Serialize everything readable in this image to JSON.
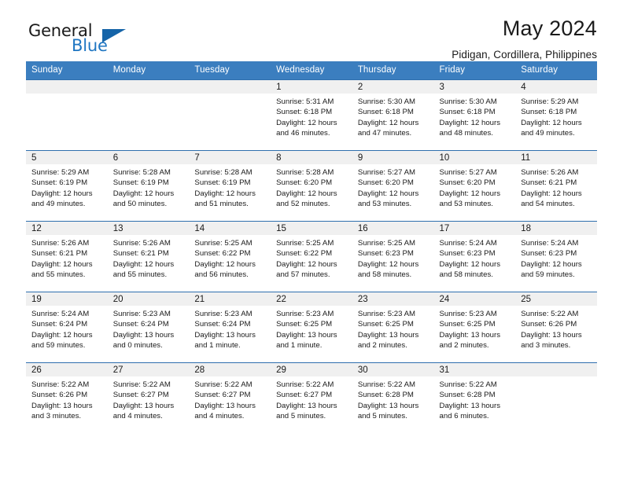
{
  "brand": {
    "name_top": "General",
    "name_bottom": "Blue",
    "triangle_color": "#1564a8",
    "blue_text_color": "#1f76c2"
  },
  "header": {
    "title": "May 2024",
    "subtitle": "Pidigan, Cordillera, Philippines"
  },
  "theme": {
    "header_bg": "#3b7ebf",
    "row_separator": "#2f6fae",
    "daynum_band": "#f0f0f0",
    "text": "#1a1a1a"
  },
  "weekday_headers": [
    "Sunday",
    "Monday",
    "Tuesday",
    "Wednesday",
    "Thursday",
    "Friday",
    "Saturday"
  ],
  "labels": {
    "sunrise_prefix": "Sunrise:",
    "sunset_prefix": "Sunset:",
    "daylight_prefix": "Daylight:"
  },
  "weeks": [
    [
      {
        "day": "",
        "empty": true,
        "sunrise": "",
        "sunset": "",
        "daylight_line1": "",
        "daylight_line2": ""
      },
      {
        "day": "",
        "empty": true,
        "sunrise": "",
        "sunset": "",
        "daylight_line1": "",
        "daylight_line2": ""
      },
      {
        "day": "",
        "empty": true,
        "sunrise": "",
        "sunset": "",
        "daylight_line1": "",
        "daylight_line2": ""
      },
      {
        "day": "1",
        "empty": false,
        "sunrise": "Sunrise: 5:31 AM",
        "sunset": "Sunset: 6:18 PM",
        "daylight_line1": "Daylight: 12 hours",
        "daylight_line2": "and 46 minutes."
      },
      {
        "day": "2",
        "empty": false,
        "sunrise": "Sunrise: 5:30 AM",
        "sunset": "Sunset: 6:18 PM",
        "daylight_line1": "Daylight: 12 hours",
        "daylight_line2": "and 47 minutes."
      },
      {
        "day": "3",
        "empty": false,
        "sunrise": "Sunrise: 5:30 AM",
        "sunset": "Sunset: 6:18 PM",
        "daylight_line1": "Daylight: 12 hours",
        "daylight_line2": "and 48 minutes."
      },
      {
        "day": "4",
        "empty": false,
        "sunrise": "Sunrise: 5:29 AM",
        "sunset": "Sunset: 6:18 PM",
        "daylight_line1": "Daylight: 12 hours",
        "daylight_line2": "and 49 minutes."
      }
    ],
    [
      {
        "day": "5",
        "empty": false,
        "sunrise": "Sunrise: 5:29 AM",
        "sunset": "Sunset: 6:19 PM",
        "daylight_line1": "Daylight: 12 hours",
        "daylight_line2": "and 49 minutes."
      },
      {
        "day": "6",
        "empty": false,
        "sunrise": "Sunrise: 5:28 AM",
        "sunset": "Sunset: 6:19 PM",
        "daylight_line1": "Daylight: 12 hours",
        "daylight_line2": "and 50 minutes."
      },
      {
        "day": "7",
        "empty": false,
        "sunrise": "Sunrise: 5:28 AM",
        "sunset": "Sunset: 6:19 PM",
        "daylight_line1": "Daylight: 12 hours",
        "daylight_line2": "and 51 minutes."
      },
      {
        "day": "8",
        "empty": false,
        "sunrise": "Sunrise: 5:28 AM",
        "sunset": "Sunset: 6:20 PM",
        "daylight_line1": "Daylight: 12 hours",
        "daylight_line2": "and 52 minutes."
      },
      {
        "day": "9",
        "empty": false,
        "sunrise": "Sunrise: 5:27 AM",
        "sunset": "Sunset: 6:20 PM",
        "daylight_line1": "Daylight: 12 hours",
        "daylight_line2": "and 53 minutes."
      },
      {
        "day": "10",
        "empty": false,
        "sunrise": "Sunrise: 5:27 AM",
        "sunset": "Sunset: 6:20 PM",
        "daylight_line1": "Daylight: 12 hours",
        "daylight_line2": "and 53 minutes."
      },
      {
        "day": "11",
        "empty": false,
        "sunrise": "Sunrise: 5:26 AM",
        "sunset": "Sunset: 6:21 PM",
        "daylight_line1": "Daylight: 12 hours",
        "daylight_line2": "and 54 minutes."
      }
    ],
    [
      {
        "day": "12",
        "empty": false,
        "sunrise": "Sunrise: 5:26 AM",
        "sunset": "Sunset: 6:21 PM",
        "daylight_line1": "Daylight: 12 hours",
        "daylight_line2": "and 55 minutes."
      },
      {
        "day": "13",
        "empty": false,
        "sunrise": "Sunrise: 5:26 AM",
        "sunset": "Sunset: 6:21 PM",
        "daylight_line1": "Daylight: 12 hours",
        "daylight_line2": "and 55 minutes."
      },
      {
        "day": "14",
        "empty": false,
        "sunrise": "Sunrise: 5:25 AM",
        "sunset": "Sunset: 6:22 PM",
        "daylight_line1": "Daylight: 12 hours",
        "daylight_line2": "and 56 minutes."
      },
      {
        "day": "15",
        "empty": false,
        "sunrise": "Sunrise: 5:25 AM",
        "sunset": "Sunset: 6:22 PM",
        "daylight_line1": "Daylight: 12 hours",
        "daylight_line2": "and 57 minutes."
      },
      {
        "day": "16",
        "empty": false,
        "sunrise": "Sunrise: 5:25 AM",
        "sunset": "Sunset: 6:23 PM",
        "daylight_line1": "Daylight: 12 hours",
        "daylight_line2": "and 58 minutes."
      },
      {
        "day": "17",
        "empty": false,
        "sunrise": "Sunrise: 5:24 AM",
        "sunset": "Sunset: 6:23 PM",
        "daylight_line1": "Daylight: 12 hours",
        "daylight_line2": "and 58 minutes."
      },
      {
        "day": "18",
        "empty": false,
        "sunrise": "Sunrise: 5:24 AM",
        "sunset": "Sunset: 6:23 PM",
        "daylight_line1": "Daylight: 12 hours",
        "daylight_line2": "and 59 minutes."
      }
    ],
    [
      {
        "day": "19",
        "empty": false,
        "sunrise": "Sunrise: 5:24 AM",
        "sunset": "Sunset: 6:24 PM",
        "daylight_line1": "Daylight: 12 hours",
        "daylight_line2": "and 59 minutes."
      },
      {
        "day": "20",
        "empty": false,
        "sunrise": "Sunrise: 5:23 AM",
        "sunset": "Sunset: 6:24 PM",
        "daylight_line1": "Daylight: 13 hours",
        "daylight_line2": "and 0 minutes."
      },
      {
        "day": "21",
        "empty": false,
        "sunrise": "Sunrise: 5:23 AM",
        "sunset": "Sunset: 6:24 PM",
        "daylight_line1": "Daylight: 13 hours",
        "daylight_line2": "and 1 minute."
      },
      {
        "day": "22",
        "empty": false,
        "sunrise": "Sunrise: 5:23 AM",
        "sunset": "Sunset: 6:25 PM",
        "daylight_line1": "Daylight: 13 hours",
        "daylight_line2": "and 1 minute."
      },
      {
        "day": "23",
        "empty": false,
        "sunrise": "Sunrise: 5:23 AM",
        "sunset": "Sunset: 6:25 PM",
        "daylight_line1": "Daylight: 13 hours",
        "daylight_line2": "and 2 minutes."
      },
      {
        "day": "24",
        "empty": false,
        "sunrise": "Sunrise: 5:23 AM",
        "sunset": "Sunset: 6:25 PM",
        "daylight_line1": "Daylight: 13 hours",
        "daylight_line2": "and 2 minutes."
      },
      {
        "day": "25",
        "empty": false,
        "sunrise": "Sunrise: 5:22 AM",
        "sunset": "Sunset: 6:26 PM",
        "daylight_line1": "Daylight: 13 hours",
        "daylight_line2": "and 3 minutes."
      }
    ],
    [
      {
        "day": "26",
        "empty": false,
        "sunrise": "Sunrise: 5:22 AM",
        "sunset": "Sunset: 6:26 PM",
        "daylight_line1": "Daylight: 13 hours",
        "daylight_line2": "and 3 minutes."
      },
      {
        "day": "27",
        "empty": false,
        "sunrise": "Sunrise: 5:22 AM",
        "sunset": "Sunset: 6:27 PM",
        "daylight_line1": "Daylight: 13 hours",
        "daylight_line2": "and 4 minutes."
      },
      {
        "day": "28",
        "empty": false,
        "sunrise": "Sunrise: 5:22 AM",
        "sunset": "Sunset: 6:27 PM",
        "daylight_line1": "Daylight: 13 hours",
        "daylight_line2": "and 4 minutes."
      },
      {
        "day": "29",
        "empty": false,
        "sunrise": "Sunrise: 5:22 AM",
        "sunset": "Sunset: 6:27 PM",
        "daylight_line1": "Daylight: 13 hours",
        "daylight_line2": "and 5 minutes."
      },
      {
        "day": "30",
        "empty": false,
        "sunrise": "Sunrise: 5:22 AM",
        "sunset": "Sunset: 6:28 PM",
        "daylight_line1": "Daylight: 13 hours",
        "daylight_line2": "and 5 minutes."
      },
      {
        "day": "31",
        "empty": false,
        "sunrise": "Sunrise: 5:22 AM",
        "sunset": "Sunset: 6:28 PM",
        "daylight_line1": "Daylight: 13 hours",
        "daylight_line2": "and 6 minutes."
      },
      {
        "day": "",
        "empty": true,
        "sunrise": "",
        "sunset": "",
        "daylight_line1": "",
        "daylight_line2": ""
      }
    ]
  ]
}
